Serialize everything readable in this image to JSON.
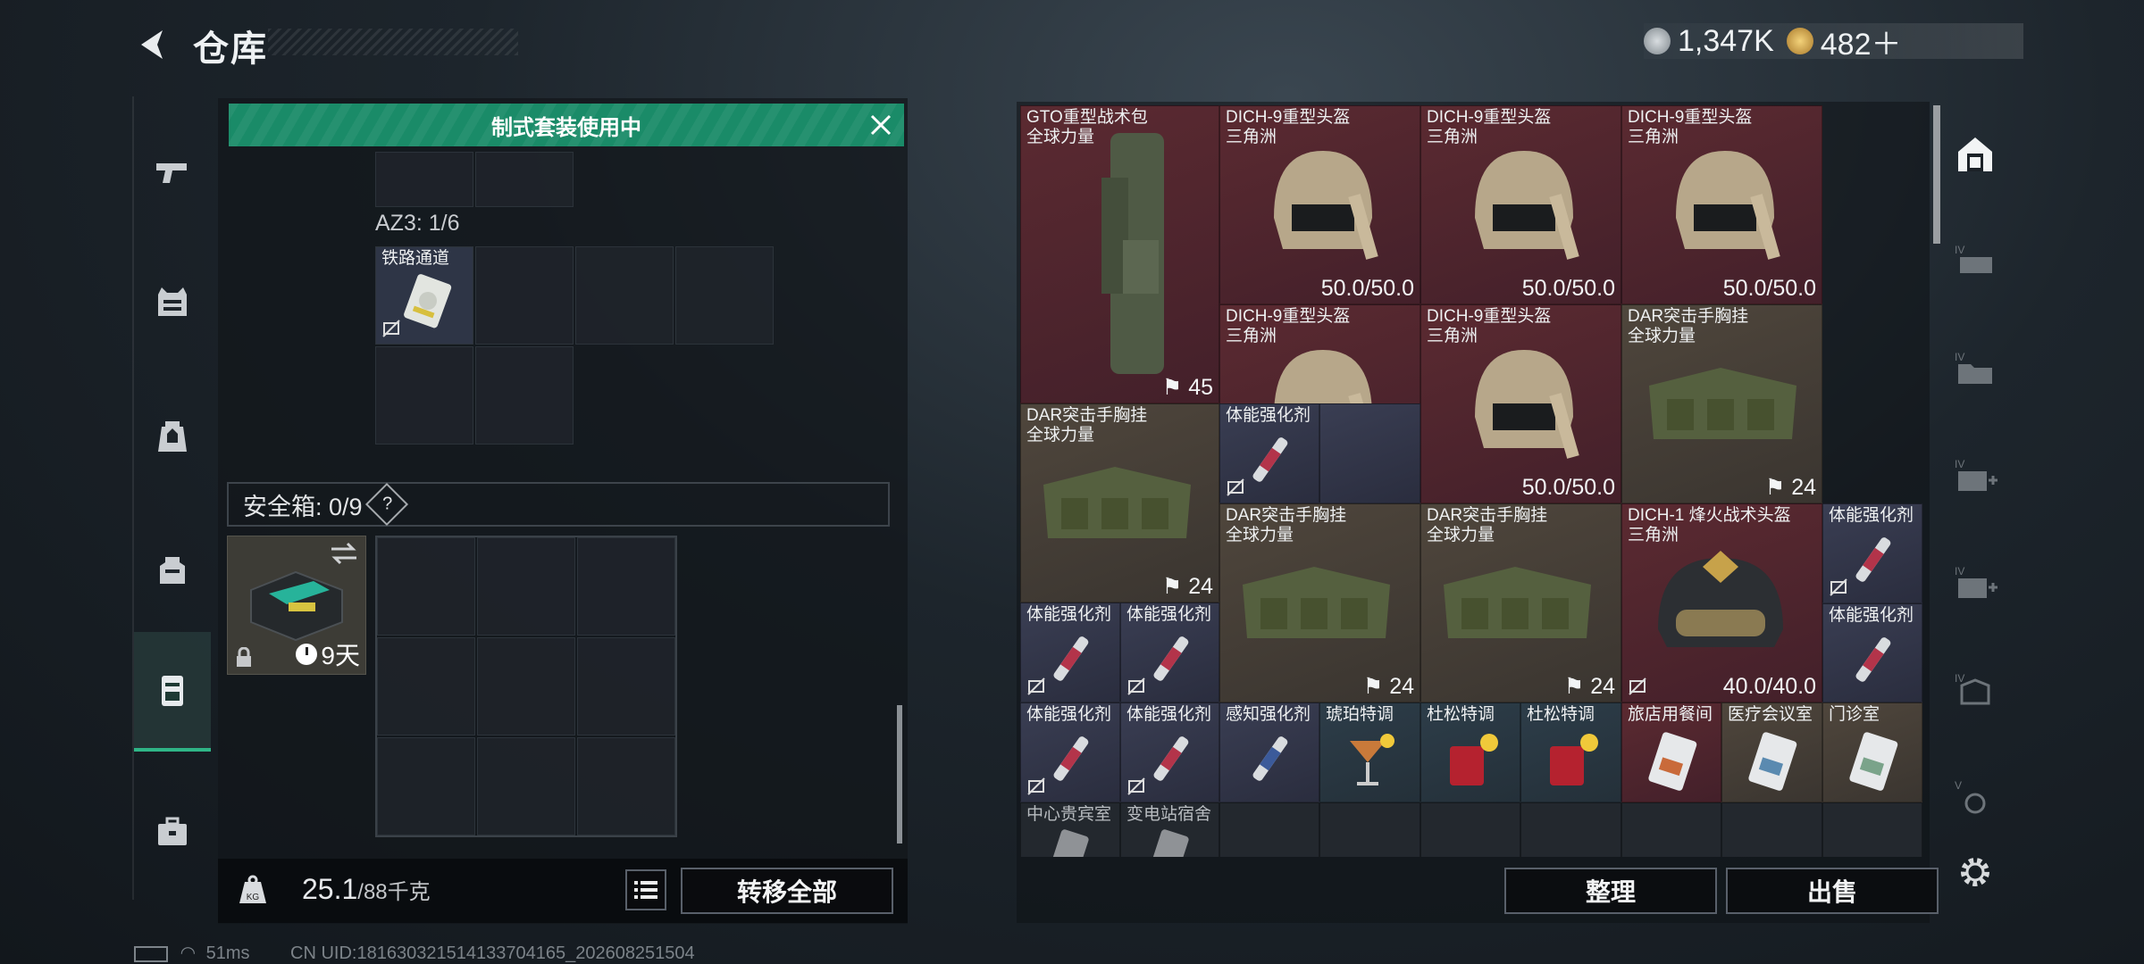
{
  "header": {
    "title": "仓库",
    "currency_a": "1,347K",
    "currency_b": "482＋"
  },
  "left_panel": {
    "banner": "制式套装使用中",
    "az3_label": "AZ3: 1/6",
    "az3_item": "铁路通道",
    "safe_box_label": "安全箱: 0/9",
    "safe_help": "?",
    "safe_item_time": "9天",
    "weight_value": "25.1",
    "weight_unit": "/88千克",
    "transfer_all": "转移全部"
  },
  "items": {
    "gto_name": "GTO重型战术包",
    "gto_sub": "全球力量",
    "gto_info": "45",
    "helmet_name": "DICH-9重型头盔",
    "helmet_sub": "三角洲",
    "helmet_info": "50.0/50.0",
    "dar_name": "DAR突击手胸挂",
    "dar_sub": "全球力量",
    "dar_info": "24",
    "dich1_name": "DICH-1 烽火战术头盔",
    "dich1_sub": "三角洲",
    "dich1_info": "40.0/40.0",
    "stim": "体能强化剂",
    "perception": "感知强化剂",
    "amber": "琥珀特调",
    "dusong": "杜松特调",
    "hotel": "旅店用餐间",
    "medical": "医疗会议室",
    "clinic": "门诊室",
    "center": "中心贵宾室",
    "substation": "变电站宿舍"
  },
  "right_buttons": {
    "sort": "整理",
    "sell": "出售"
  },
  "status_bar": {
    "ping": "51ms",
    "uid": "CN UID:18163032151413370416​5_202608251504"
  },
  "colors": {
    "accent": "#1a8b68",
    "rarity_red": "#5b2a31",
    "rarity_brown": "#4f463c",
    "rarity_blue": "#3a3e53"
  }
}
